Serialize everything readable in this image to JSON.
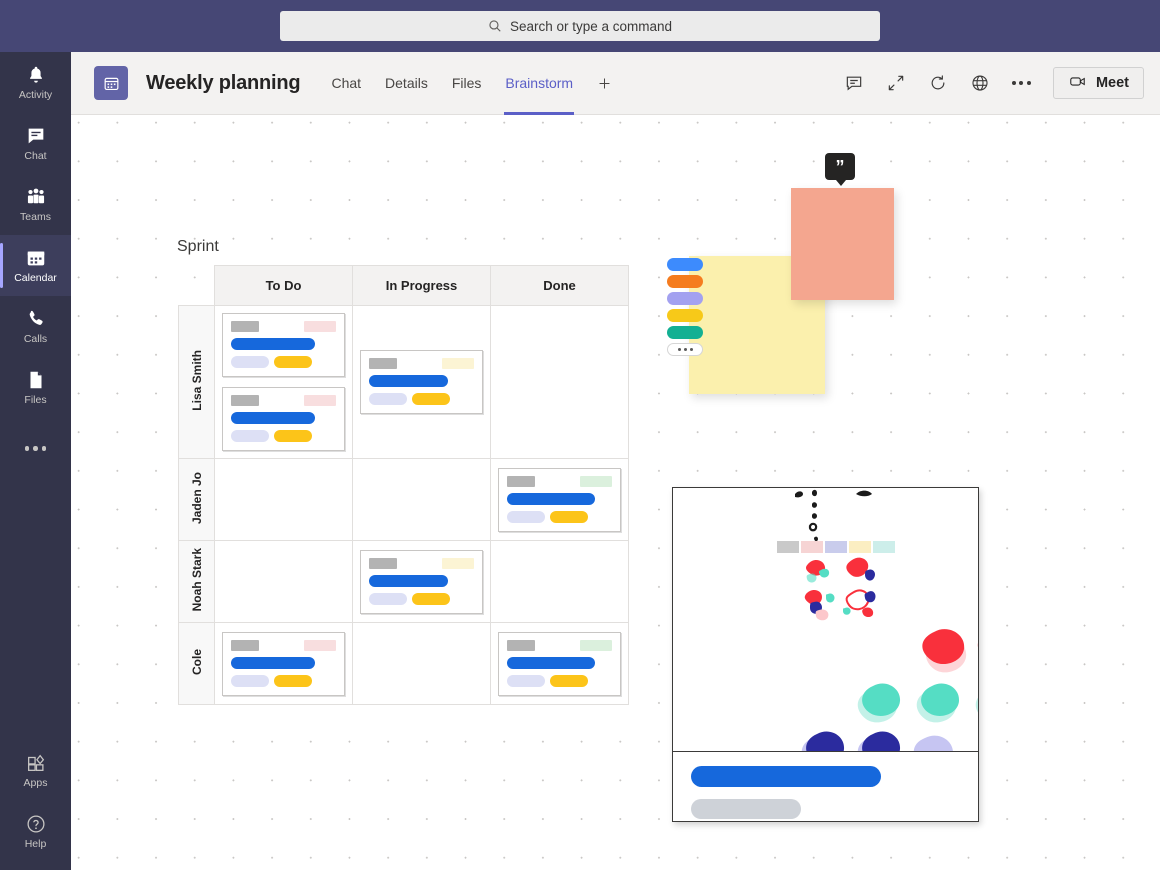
{
  "topbar": {
    "search": {
      "placeholder": "Search or type a command",
      "icon": "search-icon"
    }
  },
  "rail": {
    "items": [
      {
        "label": "Activity",
        "icon": "bell-icon",
        "active": false
      },
      {
        "label": "Chat",
        "icon": "chat-bubble-icon",
        "active": false
      },
      {
        "label": "Teams",
        "icon": "people-icon",
        "active": false
      },
      {
        "label": "Calendar",
        "icon": "calendar-icon",
        "active": true
      },
      {
        "label": "Calls",
        "icon": "phone-icon",
        "active": false
      },
      {
        "label": "Files",
        "icon": "file-icon",
        "active": false
      },
      {
        "label": "",
        "icon": "more-horizontal-icon",
        "active": false
      }
    ],
    "bottom": [
      {
        "label": "Apps",
        "icon": "apps-icon"
      },
      {
        "label": "Help",
        "icon": "help-circle-icon"
      }
    ]
  },
  "header": {
    "logo_icon": "calendar-icon",
    "title": "Weekly planning",
    "tabs": [
      {
        "label": "Chat",
        "selected": false
      },
      {
        "label": "Details",
        "selected": false
      },
      {
        "label": "Files",
        "selected": false
      },
      {
        "label": "Brainstorm",
        "selected": true
      }
    ],
    "add_tab_label": "+",
    "actions": [
      {
        "name": "conversation-icon"
      },
      {
        "name": "expand-icon"
      },
      {
        "name": "refresh-icon"
      },
      {
        "name": "globe-icon"
      },
      {
        "name": "more-horizontal-icon"
      }
    ],
    "meet": {
      "label": "Meet",
      "icon": "video-camera-icon"
    }
  },
  "board": {
    "title": "Sprint",
    "columns": [
      "To Do",
      "In Progress",
      "Done"
    ],
    "rows": [
      {
        "name": "Lisa Smith",
        "cells": [
          [
            {
              "tag_color": "pink",
              "bar": "w80"
            },
            {
              "tag_color": "pink",
              "bar": "w80"
            }
          ],
          [
            {
              "tag_color": "cream",
              "bar": "w75"
            }
          ],
          []
        ]
      },
      {
        "name": "Jaden Jo",
        "cells": [
          [],
          [],
          [
            {
              "tag_color": "green",
              "bar": "w84"
            }
          ]
        ]
      },
      {
        "name": "Noah Stark",
        "cells": [
          [],
          [
            {
              "tag_color": "cream",
              "bar": "w75"
            }
          ],
          []
        ]
      },
      {
        "name": "Cole",
        "cells": [
          [
            {
              "tag_color": "pink",
              "bar": "w80"
            }
          ],
          [],
          [
            {
              "tag_color": "green",
              "bar": "w84"
            }
          ]
        ]
      }
    ]
  },
  "notes": {
    "yellow": {
      "color": "#fbf0ad"
    },
    "salmon": {
      "color": "#f4a68f"
    },
    "quote_badge": {
      "glyph": "”",
      "icon": "quote-icon"
    },
    "palette": [
      {
        "name": "color-blue",
        "hex": "#3d8bfd"
      },
      {
        "name": "color-orange",
        "hex": "#f57c1f"
      },
      {
        "name": "color-purple",
        "hex": "#a3a1f0"
      },
      {
        "name": "color-yellow",
        "hex": "#f7c919"
      },
      {
        "name": "color-teal",
        "hex": "#13b093"
      },
      {
        "name": "color-more",
        "hex": "#ffffff"
      }
    ]
  },
  "panel": {
    "swatches": [
      "#c9c9c9",
      "#f6d4d4",
      "#c9ccec",
      "#fbeec2",
      "#cdeeea"
    ],
    "blob_colors": {
      "red": "#f9303c",
      "red_light": "#fcc7cb",
      "teal": "#55ddc4",
      "teal_light": "#c3f1e8",
      "navy": "#2b2b9e",
      "navy_light": "#c6c5f2"
    },
    "footer": {
      "primary_color": "#1668dc",
      "secondary_color": "#ced2d8"
    }
  }
}
